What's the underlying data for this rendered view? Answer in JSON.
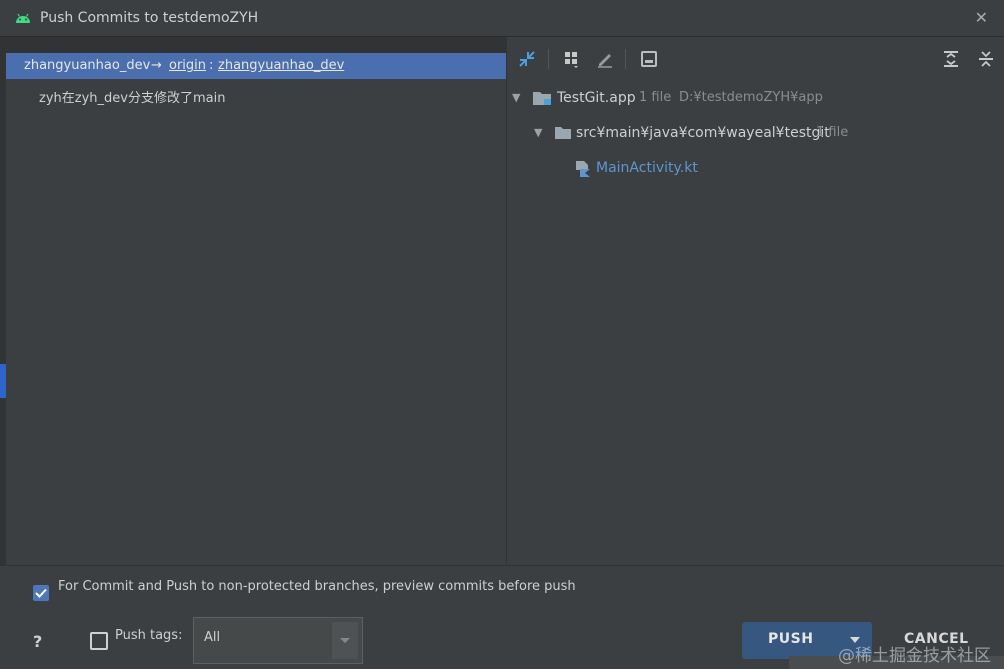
{
  "window": {
    "title": "Push Commits to testdemoZYH",
    "close_symbol": "✕"
  },
  "left": {
    "branch": {
      "local": "zhangyuanhao_dev",
      "arrow": "→",
      "remote": "origin",
      "colon": ":",
      "target": "zhangyuanhao_dev"
    },
    "commits": [
      "zyh在zyh_dev分支修改了main"
    ]
  },
  "tree": {
    "root": {
      "name": "TestGit.app",
      "count": "1 file",
      "path": "D:¥testdemoZYH¥app"
    },
    "folder": {
      "name": "src¥main¥java¥com¥wayeal¥testgit",
      "count": "1 file"
    },
    "file": {
      "name": "MainActivity.kt"
    }
  },
  "bottom": {
    "preview_label": "For Commit and Push to non-protected branches, preview commits before push",
    "preview_checked": true,
    "help": "?",
    "push_tags_label": "Push tags:",
    "push_tags_checked": false,
    "tags_value": "All",
    "push_label": "PUSH",
    "cancel_label": "CANCEL",
    "watermark": "@稀土掘金技术社区"
  },
  "colors": {
    "selection": "#4b6eaf",
    "panel": "#3c3f41",
    "push_button": "#365880",
    "link_blue": "#5d96cf"
  },
  "icons": [
    "android-icon",
    "expand-arrows-icon",
    "group-by-icon",
    "edit-icon",
    "save-icon",
    "expand-all-icon",
    "collapse-all-icon",
    "folder-icon",
    "kotlin-file-icon"
  ]
}
